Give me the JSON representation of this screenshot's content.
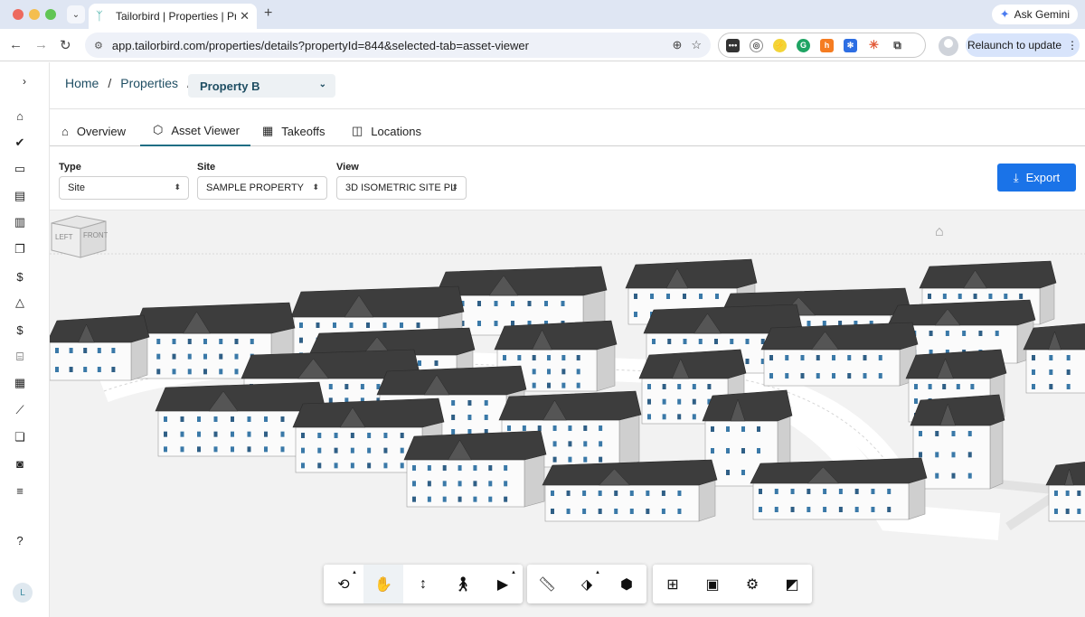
{
  "browser": {
    "tab_title": "Tailorbird | Properties | Projec",
    "url": "app.tailorbird.com/properties/details?propertyId=844&selected-tab=asset-viewer",
    "ask_gemini": "Ask Gemini",
    "relaunch": "Relaunch to update"
  },
  "breadcrumb": {
    "home": "Home",
    "properties": "Properties",
    "separator": "/",
    "selected_property": "Property B"
  },
  "tabs": [
    {
      "label": "Overview",
      "icon": "home-icon"
    },
    {
      "label": "Asset Viewer",
      "icon": "cube-icon",
      "active": true
    },
    {
      "label": "Takeoffs",
      "icon": "calculator-icon"
    },
    {
      "label": "Locations",
      "icon": "map-icon"
    }
  ],
  "filters": {
    "type": {
      "label": "Type",
      "value": "Site"
    },
    "site": {
      "label": "Site",
      "value": "SAMPLE PROPERTY"
    },
    "view": {
      "label": "View",
      "value": "3D ISOMETRIC SITE PL"
    }
  },
  "export_label": "Export",
  "view_cube": {
    "left": "LEFT",
    "front": "FRONT"
  },
  "rail_user_initial": "L",
  "colors": {
    "accent": "#1a73e8",
    "primary_text": "#1f4e63",
    "roof": "#3d3d3d",
    "wall": "#fbfbfb",
    "window": "#3a79a8"
  }
}
